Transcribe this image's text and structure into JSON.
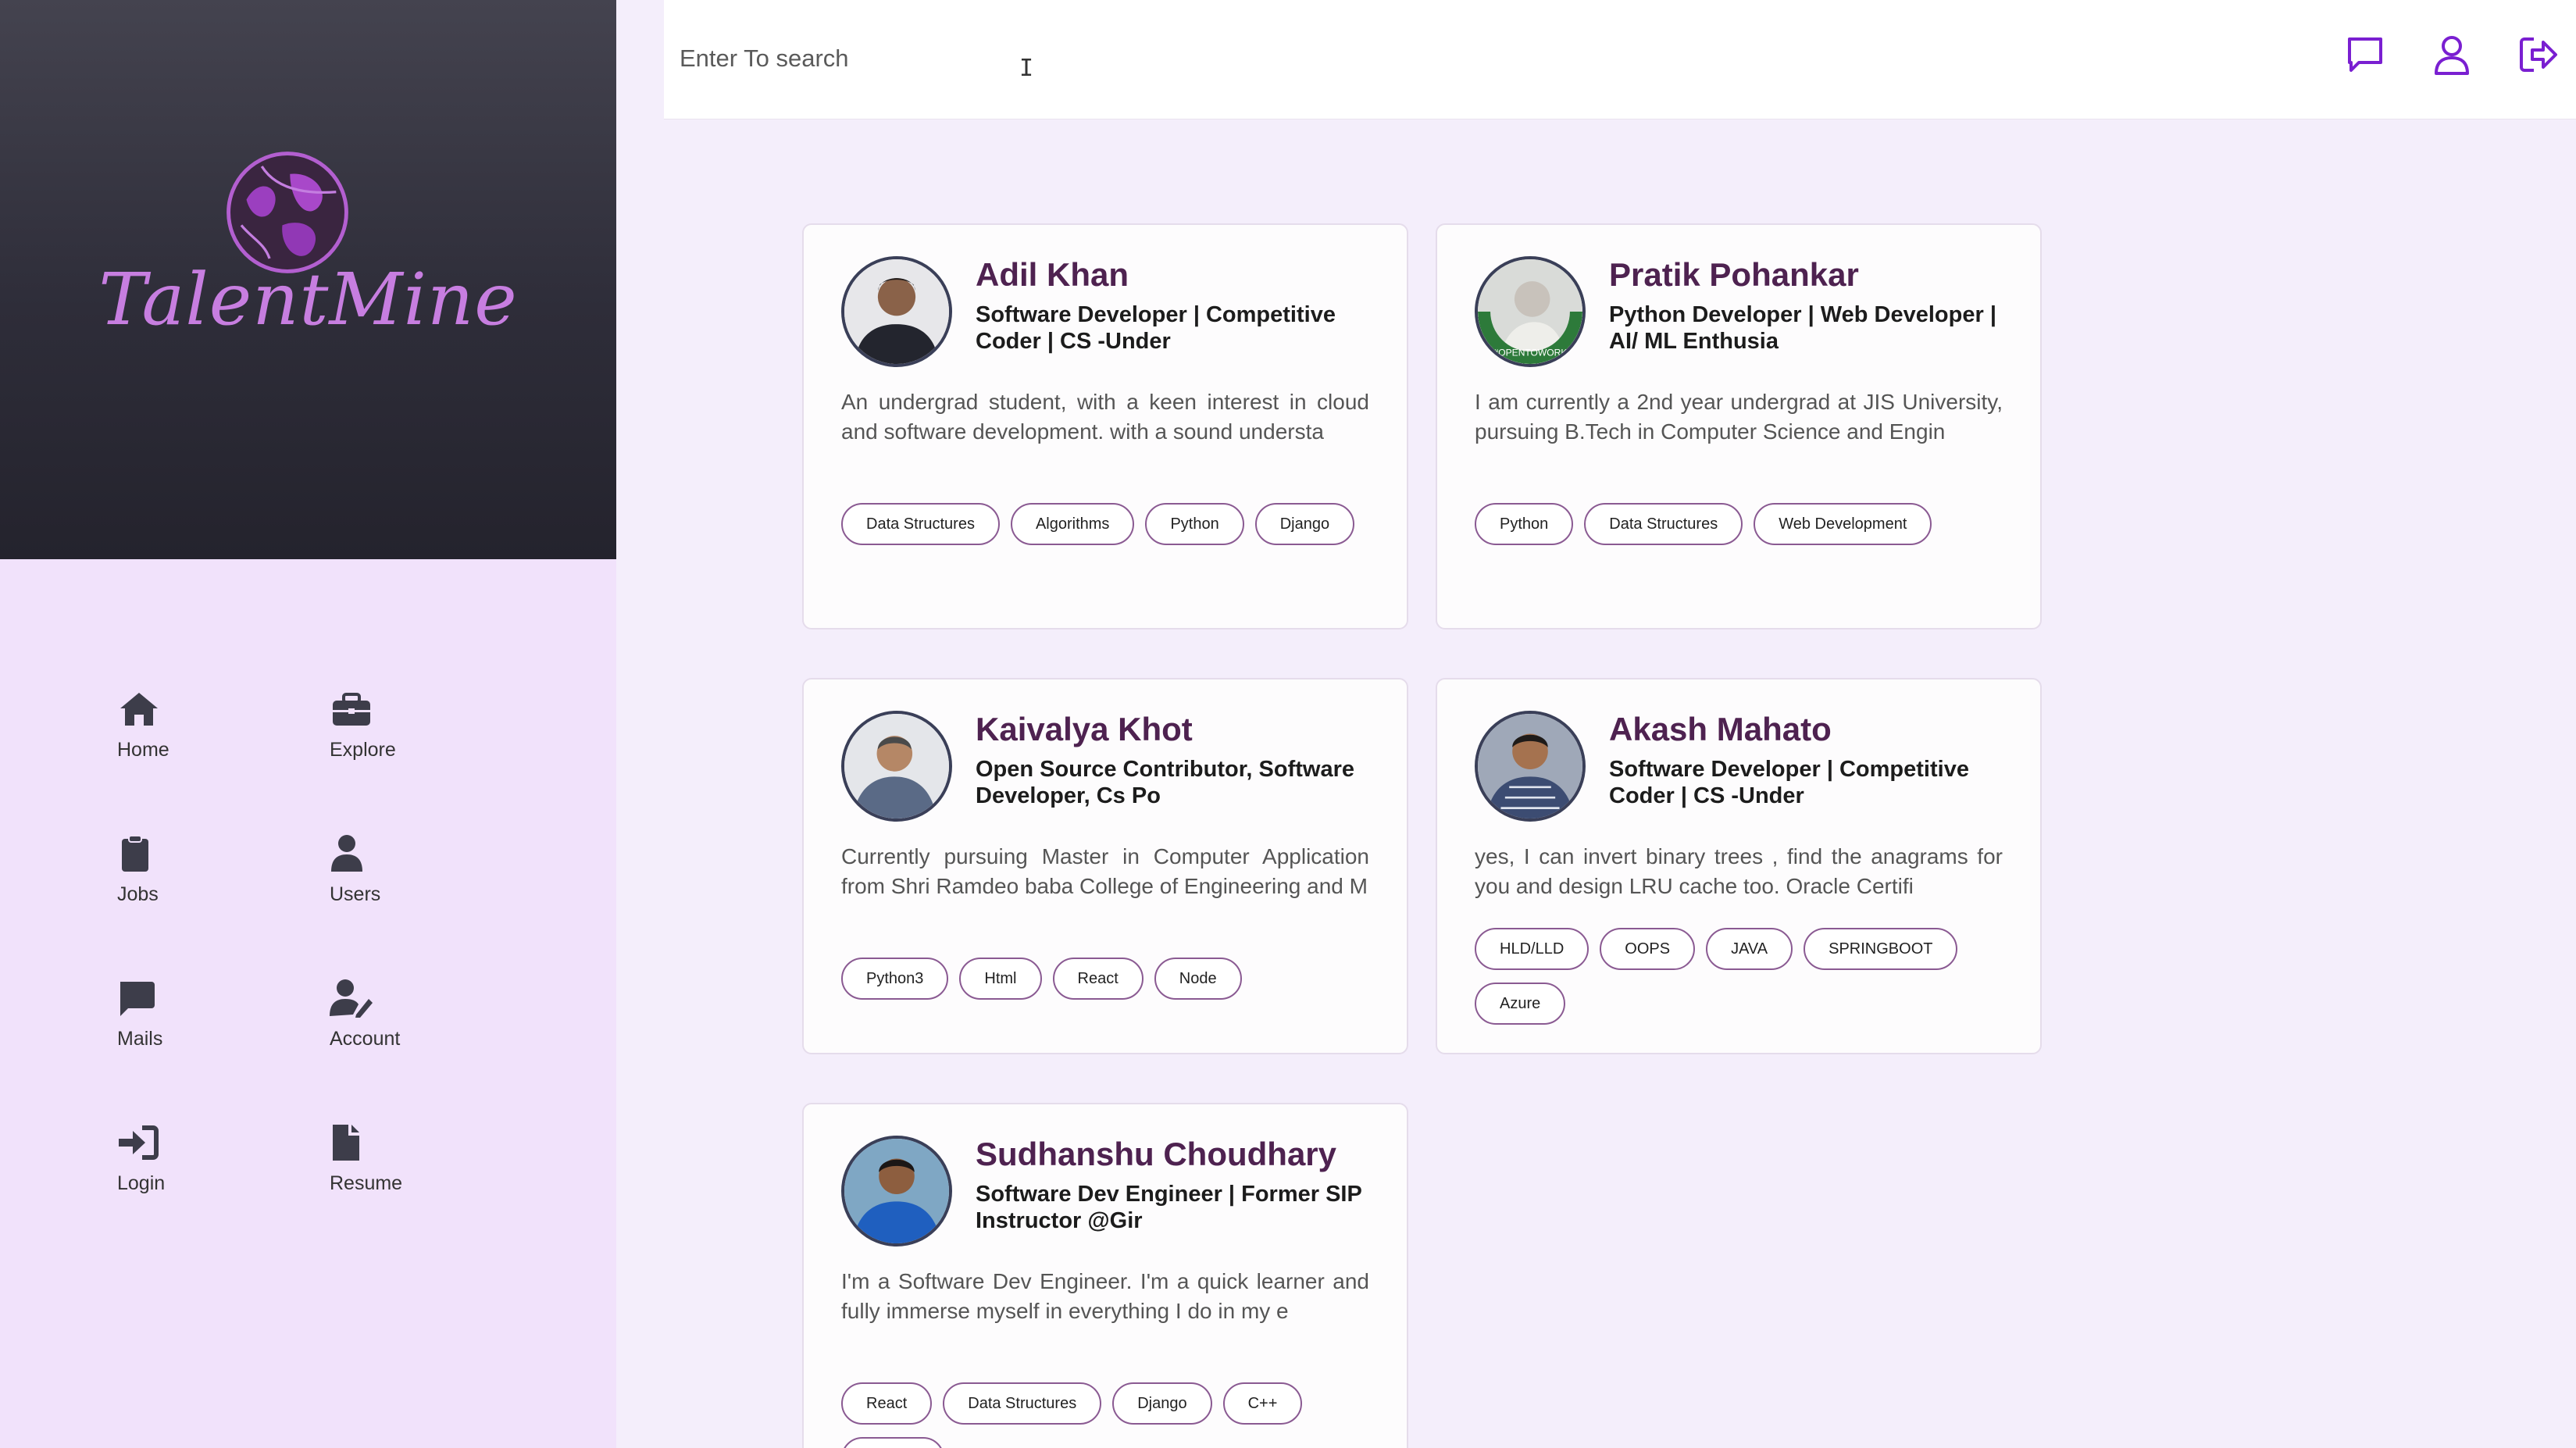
{
  "brand": {
    "name": "TalentMine"
  },
  "search": {
    "placeholder": "Enter To search"
  },
  "nav": [
    {
      "label": "Home",
      "icon": "home-icon"
    },
    {
      "label": "Explore",
      "icon": "briefcase-icon"
    },
    {
      "label": "Jobs",
      "icon": "clipboard-icon"
    },
    {
      "label": "Users",
      "icon": "user-icon"
    },
    {
      "label": "Mails",
      "icon": "message-icon"
    },
    {
      "label": "Account",
      "icon": "user-edit-icon"
    },
    {
      "label": "Login",
      "icon": "login-icon"
    },
    {
      "label": "Resume",
      "icon": "file-icon"
    }
  ],
  "top_icons": [
    "chat-icon",
    "profile-icon",
    "logout-icon"
  ],
  "colors": {
    "accent": "#7a1fd1",
    "name": "#4e2250",
    "sidebar": "#f1e2fb",
    "background": "#f4eefb"
  },
  "cards": [
    {
      "name": "Adil Khan",
      "headline": "Software Developer | Competitive Coder | CS -Under",
      "bio": "An undergrad student, with a keen interest in cloud and software development. with a sound understa",
      "tags": [
        "Data Structures",
        "Algorithms",
        "Python",
        "Django"
      ]
    },
    {
      "name": "Pratik Pohankar",
      "headline": "Python Developer | Web Developer | AI/ ML Enthusia",
      "bio": "I am currently a 2nd year undergrad at JIS University, pursuing B.Tech in Computer Science and Engin",
      "tags": [
        "Python",
        "Data Structures",
        "Web Development"
      ],
      "avatar_text": "#OPENTOWORK"
    },
    {
      "name": "Kaivalya Khot",
      "headline": "Open Source Contributor, Software Developer, Cs Po",
      "bio": "Currently pursuing Master in Computer Application from Shri Ramdeo baba College of Engineering and M",
      "tags": [
        "Python3",
        "Html",
        "React",
        "Node"
      ]
    },
    {
      "name": "Akash Mahato",
      "headline": "Software Developer | Competitive Coder | CS -Under",
      "bio": "yes, I can invert binary trees , find the anagrams for you and design LRU cache too. Oracle Certifi",
      "tags": [
        "HLD/LLD",
        "OOPS",
        "JAVA",
        "SPRINGBOOT",
        "Azure"
      ]
    },
    {
      "name": "Sudhanshu Choudhary",
      "headline": "Software Dev Engineer | Former SIP Instructor @Gir",
      "bio": "I'm a Software Dev Engineer. I'm a quick learner and fully immerse myself in everything I do in my e",
      "tags": [
        "React",
        "Data Structures",
        "Django",
        "C++",
        ""
      ]
    }
  ]
}
